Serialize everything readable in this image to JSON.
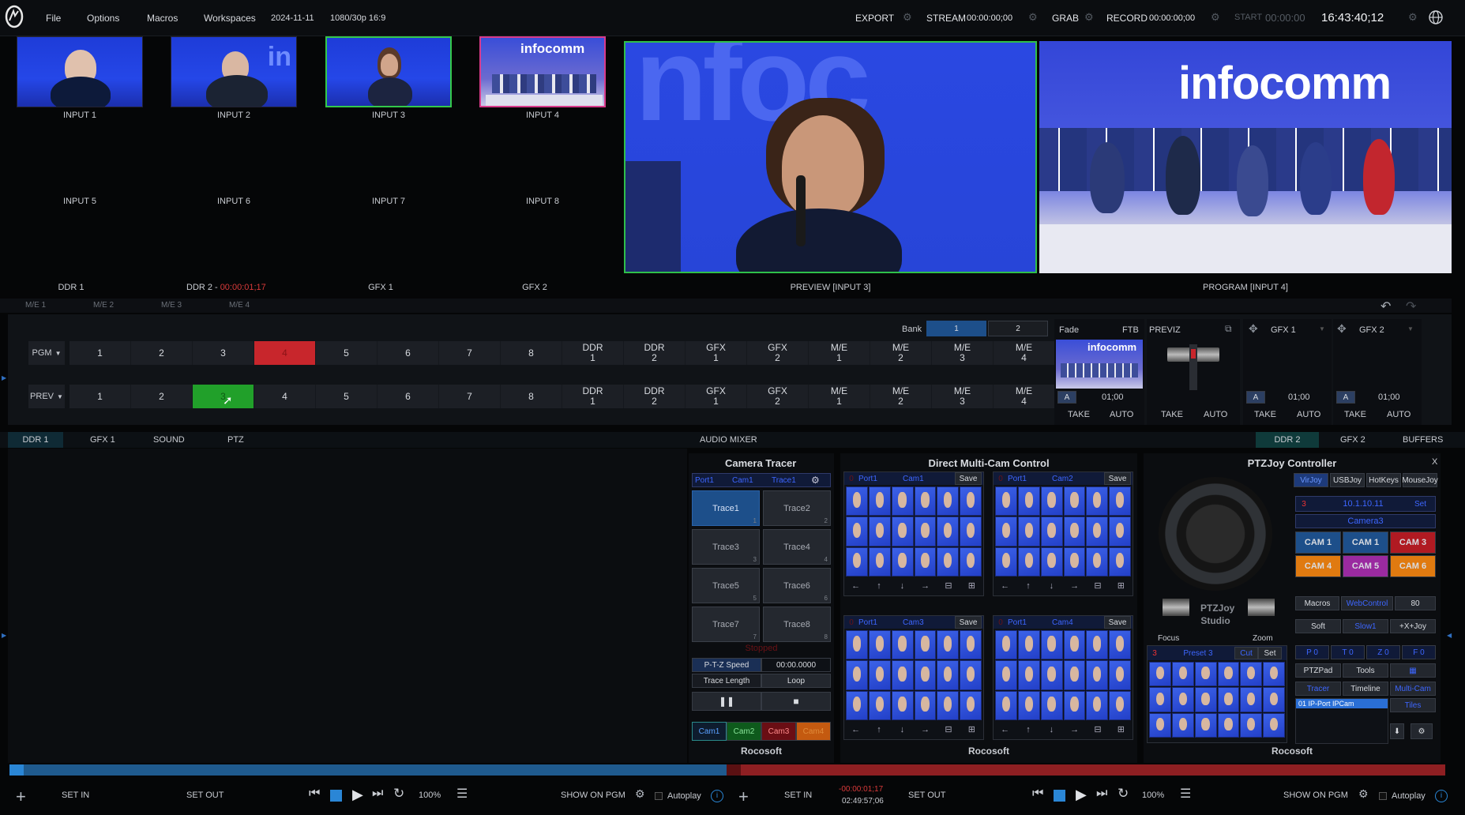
{
  "topbar": {
    "menu": [
      "File",
      "Options",
      "Macros",
      "Workspaces"
    ],
    "date": "2024-11-11",
    "format": "1080/30p 16:9",
    "export_label": "EXPORT",
    "stream_label": "STREAM",
    "stream_time": "00:00:00;00",
    "grab_label": "GRAB",
    "record_label": "RECORD",
    "record_time": "00:00:00;00",
    "start_label": "START",
    "start_time": "00:00:00",
    "clock": "16:43:40;12"
  },
  "inputs": {
    "row1": [
      "INPUT 1",
      "INPUT 2",
      "INPUT 3",
      "INPUT 4"
    ],
    "row2": [
      "INPUT 5",
      "INPUT 6",
      "INPUT 7",
      "INPUT 8"
    ],
    "row3": [
      "DDR 1",
      "DDR 2",
      "GFX 1",
      "GFX 2"
    ],
    "ddr2_time": "00:00:01;17",
    "thumb4_text": "infocomm"
  },
  "monitors": {
    "preview_label": "PREVIEW [INPUT 3]",
    "program_label": "PROGRAM [INPUT 4]",
    "program_text": "infocomm"
  },
  "me_tabs": [
    "M/E 1",
    "M/E 2",
    "M/E 3",
    "M/E 4"
  ],
  "switcher": {
    "bank_label": "Bank",
    "bank1": "1",
    "bank2": "2",
    "pgm_label": "PGM",
    "prev_label": "PREV",
    "buttons": [
      "1",
      "2",
      "3",
      "4",
      "5",
      "6",
      "7",
      "8"
    ],
    "buttons2": [
      [
        "DDR",
        "1"
      ],
      [
        "DDR",
        "2"
      ],
      [
        "GFX",
        "1"
      ],
      [
        "GFX",
        "2"
      ],
      [
        "M/E",
        "1"
      ],
      [
        "M/E",
        "2"
      ],
      [
        "M/E",
        "3"
      ],
      [
        "M/E",
        "4"
      ]
    ],
    "fade_label": "Fade",
    "ftb_label": "FTB",
    "fade_time": "01;00",
    "take": "TAKE",
    "auto": "AUTO",
    "previz_label": "PREVIZ",
    "gfx1_label": "GFX 1",
    "gfx2_label": "GFX 2",
    "gfx1_time": "01;00",
    "gfx2_time": "01;00",
    "thumb_text": "infocomm"
  },
  "lower_tabs": {
    "left": [
      "DDR 1",
      "GFX 1",
      "SOUND",
      "PTZ"
    ],
    "center": "AUDIO MIXER",
    "right": [
      "DDR 2",
      "GFX 2",
      "BUFFERS"
    ]
  },
  "tracer": {
    "title": "Camera Tracer",
    "port": "Port1",
    "cam": "Cam1",
    "trace": "Trace1",
    "traces": [
      "Trace1",
      "Trace2",
      "Trace3",
      "Trace4",
      "Trace5",
      "Trace6",
      "Trace7",
      "Trace8"
    ],
    "stopped": "Stopped",
    "ptz_speed_label": "P-T-Z Speed",
    "ptz_speed_value": "00:00.0000",
    "trace_length_label": "Trace Length",
    "trace_length_value": "Loop",
    "cams": [
      "Cam1",
      "Cam2",
      "Cam3",
      "Cam4"
    ],
    "footer": "Rocosoft"
  },
  "multicam": {
    "title": "Direct Multi-Cam Control",
    "save": "Save",
    "blocks": [
      {
        "port": "Port1",
        "cam": "Cam1"
      },
      {
        "port": "Port1",
        "cam": "Cam2"
      },
      {
        "port": "Port1",
        "cam": "Cam3"
      },
      {
        "port": "Port1",
        "cam": "Cam4"
      }
    ],
    "footer": "Rocosoft"
  },
  "ptzjoy": {
    "title": "PTZJoy Controller",
    "close": "X",
    "tabs": [
      "VirJoy",
      "USBJoy",
      "HotKeys",
      "MouseJoy"
    ],
    "ip": "10.1.10.11",
    "set": "Set",
    "camera": "Camera3",
    "cams": [
      "CAM 1",
      "CAM 1",
      "CAM 3",
      "CAM 4",
      "CAM 5",
      "CAM 6"
    ],
    "brand1": "PTZJoy",
    "brand2": "Studio",
    "focus": "Focus",
    "zoom": "Zoom",
    "preset": "Preset 3",
    "cut": "Cut",
    "macros": "Macros",
    "webcontrol": "WebControl",
    "value80": "80",
    "soft": "Soft",
    "slow": "Slow1",
    "xjoy": "+X+Joy",
    "p0": "P 0",
    "t0": "T 0",
    "z0": "Z 0",
    "f0": "F 0",
    "ptzpad": "PTZPad",
    "tools": "Tools",
    "tracer": "Tracer",
    "timeline": "Timeline",
    "multicam": "Multi-Cam",
    "tiles": "Tiles",
    "list_item": "01 IP-Port IPCam",
    "footer": "Rocosoft",
    "num3": "3"
  },
  "transport_left": {
    "set_in": "SET IN",
    "set_out": "SET OUT",
    "zoom": "100%",
    "show_on_pgm": "SHOW ON PGM",
    "autoplay": "Autoplay"
  },
  "transport_right": {
    "set_in": "SET IN",
    "time_red": "-00:00:01;17",
    "time": "02:49:57;06",
    "set_out": "SET OUT",
    "zoom": "100%",
    "show_on_pgm": "SHOW ON PGM",
    "autoplay": "Autoplay"
  },
  "colors": {
    "pgm_red": "#c8262c",
    "prev_green": "#21a02a",
    "accent_blue": "#1d4f8a"
  }
}
